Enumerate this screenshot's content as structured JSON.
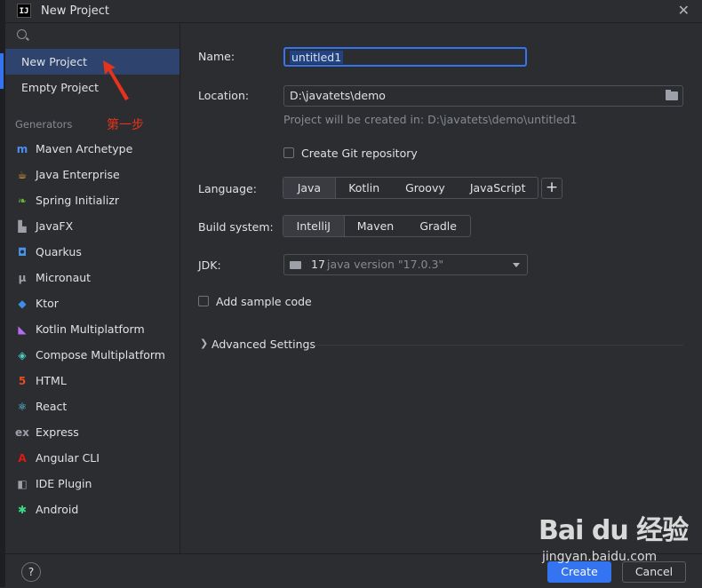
{
  "window": {
    "title": "New Project",
    "app_icon": "IJ"
  },
  "sidebar": {
    "search_placeholder": "",
    "items": [
      {
        "label": "New Project",
        "selected": true
      },
      {
        "label": "Empty Project",
        "selected": false
      }
    ],
    "section_label": "Generators",
    "generators": [
      {
        "label": "Maven Archetype",
        "icon": "maven-icon",
        "glyph": "m",
        "color": "#4b8ef2"
      },
      {
        "label": "Java Enterprise",
        "icon": "java-enterprise-icon",
        "glyph": "☕",
        "color": "#f0a732"
      },
      {
        "label": "Spring Initializr",
        "icon": "spring-icon",
        "glyph": "❧",
        "color": "#6db33f"
      },
      {
        "label": "JavaFX",
        "icon": "javafx-icon",
        "glyph": "▙",
        "color": "#9da0a8"
      },
      {
        "label": "Quarkus",
        "icon": "quarkus-icon",
        "glyph": "◘",
        "color": "#4695eb"
      },
      {
        "label": "Micronaut",
        "icon": "micronaut-icon",
        "glyph": "μ",
        "color": "#9da0a8"
      },
      {
        "label": "Ktor",
        "icon": "ktor-icon",
        "glyph": "◆",
        "color": "#3b8eea"
      },
      {
        "label": "Kotlin Multiplatform",
        "icon": "kotlin-icon",
        "glyph": "◣",
        "color": "#b46ef0"
      },
      {
        "label": "Compose Multiplatform",
        "icon": "compose-icon",
        "glyph": "◈",
        "color": "#4dd0c4"
      },
      {
        "label": "HTML",
        "icon": "html-icon",
        "glyph": "5",
        "color": "#e44d26"
      },
      {
        "label": "React",
        "icon": "react-icon",
        "glyph": "⚛",
        "color": "#61dafb"
      },
      {
        "label": "Express",
        "icon": "express-icon",
        "glyph": "ex",
        "color": "#9da0a8"
      },
      {
        "label": "Angular CLI",
        "icon": "angular-icon",
        "glyph": "A",
        "color": "#dd1b16"
      },
      {
        "label": "IDE Plugin",
        "icon": "ide-plugin-icon",
        "glyph": "◧",
        "color": "#9da0a8"
      },
      {
        "label": "Android",
        "icon": "android-icon",
        "glyph": "✱",
        "color": "#3ddc84"
      }
    ]
  },
  "annotation": {
    "text": "第一步",
    "color": "#e8331c"
  },
  "form": {
    "name_label": "Name:",
    "name_value": "untitled1",
    "location_label": "Location:",
    "location_value": "D:\\javatets\\demo",
    "location_hint": "Project will be created in: D:\\javatets\\demo\\untitled1",
    "git_label": "Create Git repository",
    "git_checked": false,
    "language_label": "Language:",
    "languages": [
      "Java",
      "Kotlin",
      "Groovy",
      "JavaScript"
    ],
    "language_selected": "Java",
    "build_label": "Build system:",
    "build_systems": [
      "IntelliJ",
      "Maven",
      "Gradle"
    ],
    "build_selected": "IntelliJ",
    "jdk_label": "JDK:",
    "jdk_number": "17",
    "jdk_version": "java version \"17.0.3\"",
    "sample_label": "Add sample code",
    "sample_checked": false,
    "advanced_label": "Advanced Settings"
  },
  "footer": {
    "help": "?",
    "create": "Create",
    "cancel": "Cancel"
  },
  "watermark": {
    "brand": "Bai du 经验",
    "url": "jingyan.baidu.com"
  },
  "colors": {
    "accent": "#3574f0",
    "selection": "#2e436e",
    "annotation": "#e8331c"
  }
}
